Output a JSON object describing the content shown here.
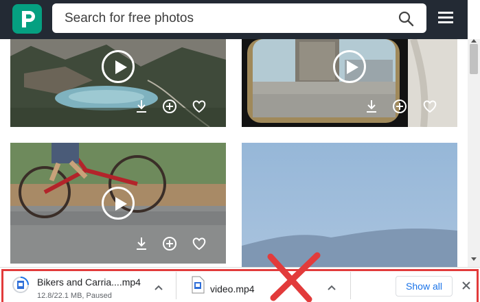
{
  "header": {
    "logo_icon": "pexels-logo-icon",
    "search": {
      "placeholder": "Search for free photos",
      "icon": "search-icon"
    },
    "menu_icon": "hamburger-menu-icon",
    "colors": {
      "bar": "#232a34",
      "brand": "#05a081"
    }
  },
  "gallery": {
    "cards": [
      {
        "scene": "mountain-lake",
        "has_play": true,
        "actions": [
          "download-icon",
          "add-to-collection-icon",
          "like-icon"
        ]
      },
      {
        "scene": "train-window-city",
        "has_play": true,
        "actions": [
          "download-icon",
          "add-to-collection-icon",
          "like-icon"
        ]
      },
      {
        "scene": "bikers-street",
        "has_play": true,
        "actions": [
          "download-icon",
          "add-to-collection-icon",
          "like-icon"
        ]
      },
      {
        "scene": "blue-sky-mountains",
        "has_play": false,
        "actions": []
      }
    ]
  },
  "downloads": {
    "items": [
      {
        "name": "Bikers and Carria....mp4",
        "status": "12.8/22.1 MB, Paused",
        "icon": "video-file-icon"
      },
      {
        "name": "video.mp4",
        "status": "",
        "icon": "video-file-icon"
      }
    ],
    "show_all_label": "Show all",
    "close_icon": "close-icon",
    "highlight_color": "#e23b3b"
  }
}
